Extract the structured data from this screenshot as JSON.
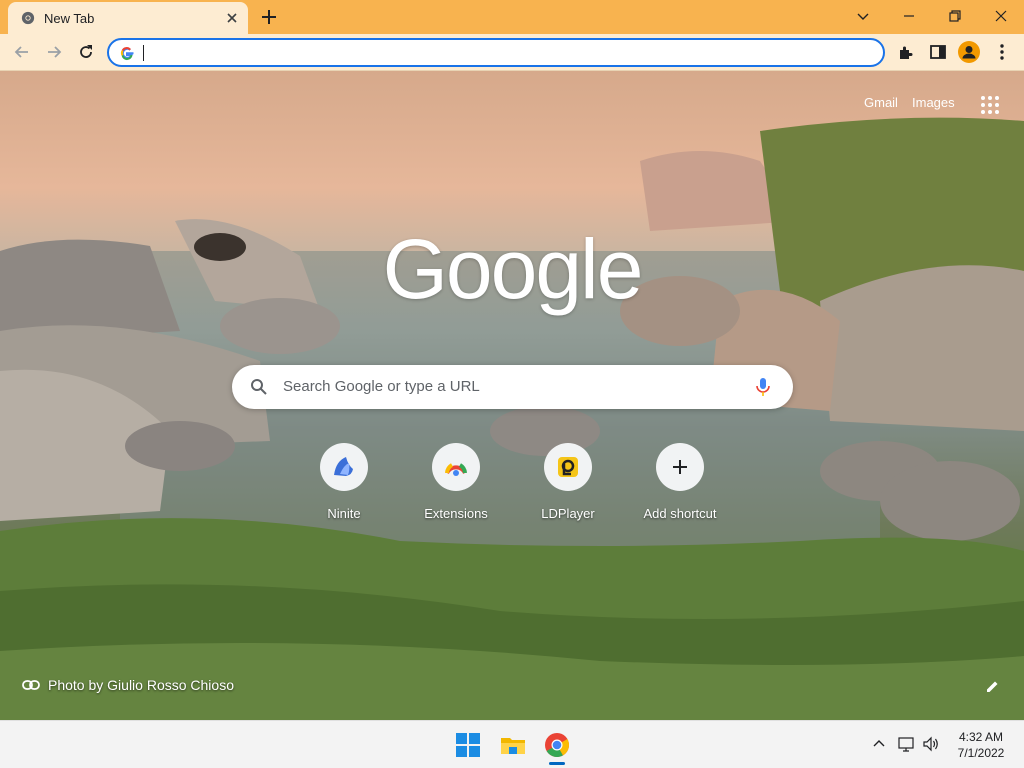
{
  "tab": {
    "title": "New Tab"
  },
  "omnibox": {
    "value": "",
    "placeholder": ""
  },
  "header_links": {
    "gmail": "Gmail",
    "images": "Images"
  },
  "logo_text": "Google",
  "search": {
    "placeholder": "Search Google or type a URL"
  },
  "shortcuts": [
    {
      "label": "Ninite",
      "icon": "ninite-icon"
    },
    {
      "label": "Extensions",
      "icon": "chrome-extensions-icon"
    },
    {
      "label": "LDPlayer",
      "icon": "ldplayer-icon"
    },
    {
      "label": "Add shortcut",
      "icon": "plus-icon"
    }
  ],
  "photo_credit": "Photo by Giulio Rosso Chioso",
  "clock": {
    "time": "4:32 AM",
    "date": "7/1/2022"
  },
  "colors": {
    "tabstrip": "#f8b34f",
    "toolbar": "#fdecd2",
    "accent": "#1a73e8",
    "avatar": "#f29900"
  }
}
